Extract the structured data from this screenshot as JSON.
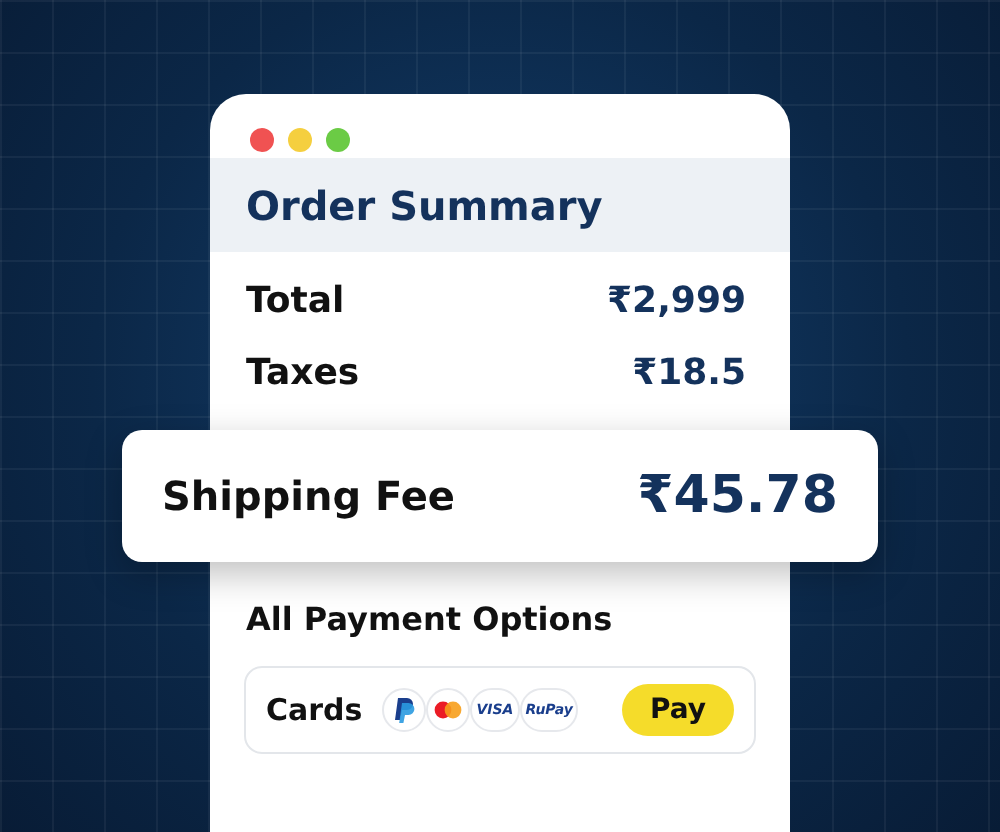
{
  "window": {
    "controls": [
      {
        "color": "#f05252"
      },
      {
        "color": "#f5cf3f"
      },
      {
        "color": "#6bcb45"
      }
    ]
  },
  "title": "Order Summary",
  "lines": [
    {
      "label": "Total",
      "value": "₹2,999"
    },
    {
      "label": "Taxes",
      "value": "₹18.5"
    }
  ],
  "highlight": {
    "label": "Shipping Fee",
    "value": "₹45.78"
  },
  "payment": {
    "heading": "All Payment Options",
    "method": "Cards",
    "logos": [
      {
        "kind": "paypal"
      },
      {
        "kind": "mastercard"
      },
      {
        "kind": "text",
        "label": "VISA"
      },
      {
        "kind": "text",
        "label": "RuPay"
      }
    ],
    "button": "Pay"
  }
}
